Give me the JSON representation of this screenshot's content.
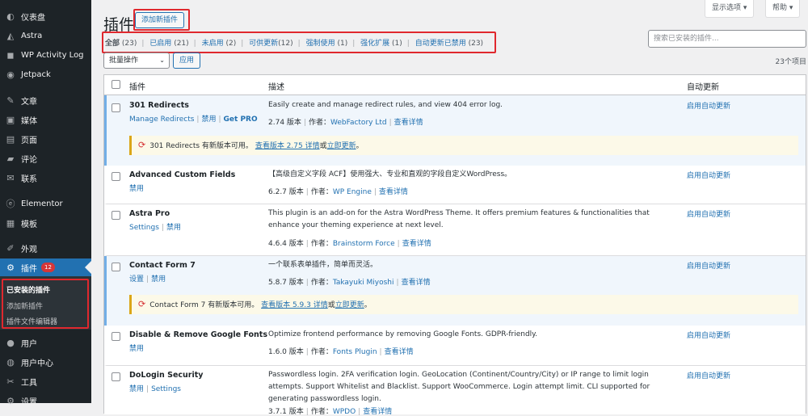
{
  "sidebar": {
    "items": [
      {
        "label": "仪表盘",
        "icon": "dashboard-icon",
        "glyph": "◐"
      },
      {
        "label": "Astra",
        "icon": "astra-icon",
        "glyph": "◭"
      },
      {
        "label": "WP Activity Log",
        "icon": "activity-log-icon",
        "glyph": "◼"
      },
      {
        "label": "Jetpack",
        "icon": "jetpack-icon",
        "glyph": "◉"
      },
      {
        "label": "文章",
        "icon": "pin-icon",
        "glyph": "✎"
      },
      {
        "label": "媒体",
        "icon": "media-icon",
        "glyph": "▣"
      },
      {
        "label": "页面",
        "icon": "page-icon",
        "glyph": "▤"
      },
      {
        "label": "评论",
        "icon": "comment-icon",
        "glyph": "▰"
      },
      {
        "label": "联系",
        "icon": "mail-icon",
        "glyph": "✉"
      },
      {
        "label": "Elementor",
        "icon": "elementor-icon",
        "glyph": "ⓔ"
      },
      {
        "label": "模板",
        "icon": "template-icon",
        "glyph": "▦"
      },
      {
        "label": "外观",
        "icon": "appearance-icon",
        "glyph": "✐"
      },
      {
        "label": "插件",
        "icon": "plugin-icon",
        "glyph": "⚙",
        "badge": "12"
      },
      {
        "label": "用户",
        "icon": "user-icon",
        "glyph": "●"
      },
      {
        "label": "用户中心",
        "icon": "user-center-icon",
        "glyph": "◍"
      },
      {
        "label": "工具",
        "icon": "tools-icon",
        "glyph": "✂"
      },
      {
        "label": "设置",
        "icon": "settings-icon",
        "glyph": "⚙"
      }
    ],
    "submenu": [
      "已安装的插件",
      "添加新插件",
      "插件文件编辑器"
    ]
  },
  "header": {
    "title": "插件",
    "add_new": "添加新插件",
    "screen_options": "显示选项",
    "help": "帮助"
  },
  "filters": [
    {
      "label": "全部",
      "count": "(23)"
    },
    {
      "label": "已启用",
      "count": "(21)"
    },
    {
      "label": "未启用",
      "count": "(2)"
    },
    {
      "label": "可供更新",
      "count": "(12)"
    },
    {
      "label": "强制使用",
      "count": "(1)"
    },
    {
      "label": "强化扩展",
      "count": "(1)"
    },
    {
      "label": "自动更新已禁用",
      "count": "(23)"
    }
  ],
  "search": {
    "placeholder": "搜索已安装的插件..."
  },
  "bulk": {
    "label": "批量操作",
    "apply": "应用",
    "items_count": "23个项目"
  },
  "table": {
    "col_plugin": "插件",
    "col_desc": "描述",
    "col_auto": "自动更新",
    "rows": [
      {
        "name": "301 Redirects",
        "links": [
          "Manage Redirects",
          "禁用",
          "Get PRO"
        ],
        "desc": "Easily create and manage redirect rules, and view 404 error log.",
        "version": "2.74 版本",
        "author_label": "作者：",
        "author": "WebFactory Ltd",
        "details": "查看详情",
        "auto": "启用自动更新",
        "notice": {
          "text": "301 Redirects 有新版本可用。",
          "view": "查看版本 2.75 详情",
          "or": "或",
          "update": "立即更新",
          "end": "。"
        }
      },
      {
        "name": "Advanced Custom Fields",
        "links": [
          "禁用"
        ],
        "desc": "【高级自定义字段 ACF】使用强大、专业和直观的字段自定义WordPress。",
        "version": "6.2.7 版本",
        "author_label": "作者：",
        "author": "WP Engine",
        "details": "查看详情",
        "auto": "启用自动更新"
      },
      {
        "name": "Astra Pro",
        "links": [
          "Settings",
          "禁用"
        ],
        "desc": "This plugin is an add-on for the Astra WordPress Theme. It offers premium features & functionalities that enhance your theming experience at next level.",
        "version": "4.6.4 版本",
        "author_label": "作者：",
        "author": "Brainstorm Force",
        "details": "查看详情",
        "auto": "启用自动更新"
      },
      {
        "name": "Contact Form 7",
        "links": [
          "设置",
          "禁用"
        ],
        "desc": "一个联系表单插件，简单而灵活。",
        "version": "5.8.7 版本",
        "author_label": "作者：",
        "author": "Takayuki Miyoshi",
        "details": "查看详情",
        "auto": "启用自动更新",
        "notice": {
          "text": "Contact Form 7 有新版本可用。",
          "view": "查看版本 5.9.3 详情",
          "or": "或",
          "update": "立即更新",
          "end": "。"
        }
      },
      {
        "name": "Disable & Remove Google Fonts",
        "links": [
          "禁用"
        ],
        "desc": "Optimize frontend performance by removing Google Fonts. GDPR-friendly.",
        "version": "1.6.0 版本",
        "author_label": "作者：",
        "author": "Fonts Plugin",
        "details": "查看详情",
        "auto": "启用自动更新"
      },
      {
        "name": "DoLogin Security",
        "links": [
          "禁用",
          "Settings"
        ],
        "desc": "Passwordless login. 2FA verification login. GeoLocation (Continent/Country/City) or IP range to limit login attempts. Support Whitelist and Blacklist. Support WooCommerce. Login attempt limit. CLI supported for generating passwordless login.",
        "version": "3.7.1 版本",
        "author_label": "作者：",
        "author": "WPDO",
        "details": "查看详情",
        "auto": "启用自动更新"
      }
    ]
  },
  "colors": {
    "accent": "#2271b1",
    "sidebar_bg": "#1d2327",
    "badge": "#d63638",
    "highlight_box": "#e0282e",
    "notice_border": "#dba617"
  }
}
